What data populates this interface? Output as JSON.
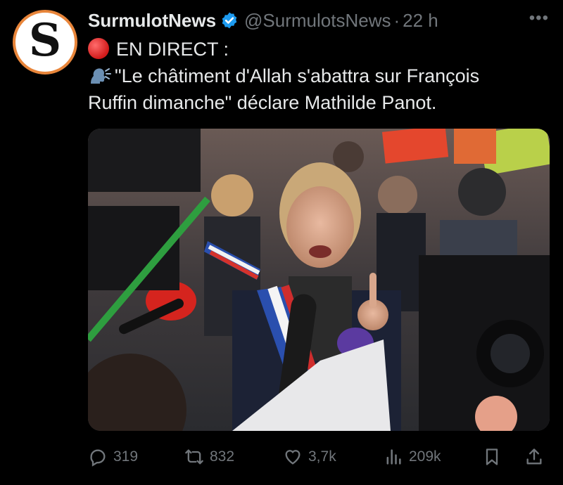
{
  "author": {
    "display_name": "SurmulotNews",
    "handle": "@SurmulotsNews",
    "separator": "·",
    "time": "22 h",
    "avatar_letter": "S",
    "verified_icon": "verified-badge-icon"
  },
  "tweet": {
    "line1": "EN DIRECT :",
    "line2": "\"Le châtiment d'Allah s'abattra sur François",
    "line3": "Ruffin dimanche\" déclare Mathilde Panot."
  },
  "actions": {
    "replies": "319",
    "reposts": "832",
    "likes": "3,7k",
    "views": "209k"
  },
  "colors": {
    "background": "#000000",
    "text": "#e7e9ea",
    "muted": "#71767b",
    "verified": "#1d9bf0",
    "avatar_ring": "#e8853a"
  }
}
